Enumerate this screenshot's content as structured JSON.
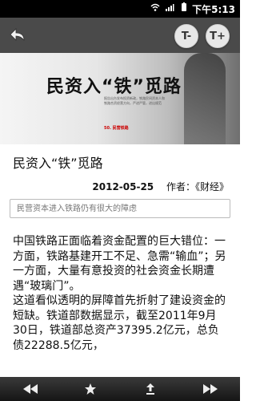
{
  "status_bar": {
    "time": "下午5:13"
  },
  "toolbar": {
    "font_decrease_label": "T-",
    "font_increase_label": "T+"
  },
  "hero": {
    "title": "民资入“铁”觅路",
    "caption": "报告出台发布投资新政，铁路民间资本人和铁路合资经营方向，严进严管，进出规范",
    "brand": "50. 民营铁路"
  },
  "article": {
    "title": "民资入“铁”觅路",
    "date": "2012-05-25",
    "author": "作者：《财经》",
    "summary": "民营资本进入铁路仍有很大的障虑",
    "paragraphs": [
      "中国铁路正面临着资金配置的巨大错位：一方面，铁路基建开工不足、急需“输血”；另一方面，大量有意投资的社会资金长期遭遇“玻璃门”。",
      "这道看似透明的屏障首先折射了建设资金的短缺。铁道部数据显示，截至2011年9月30日，铁道部总资产37395.2亿元，总负债22288.5亿元，"
    ]
  }
}
